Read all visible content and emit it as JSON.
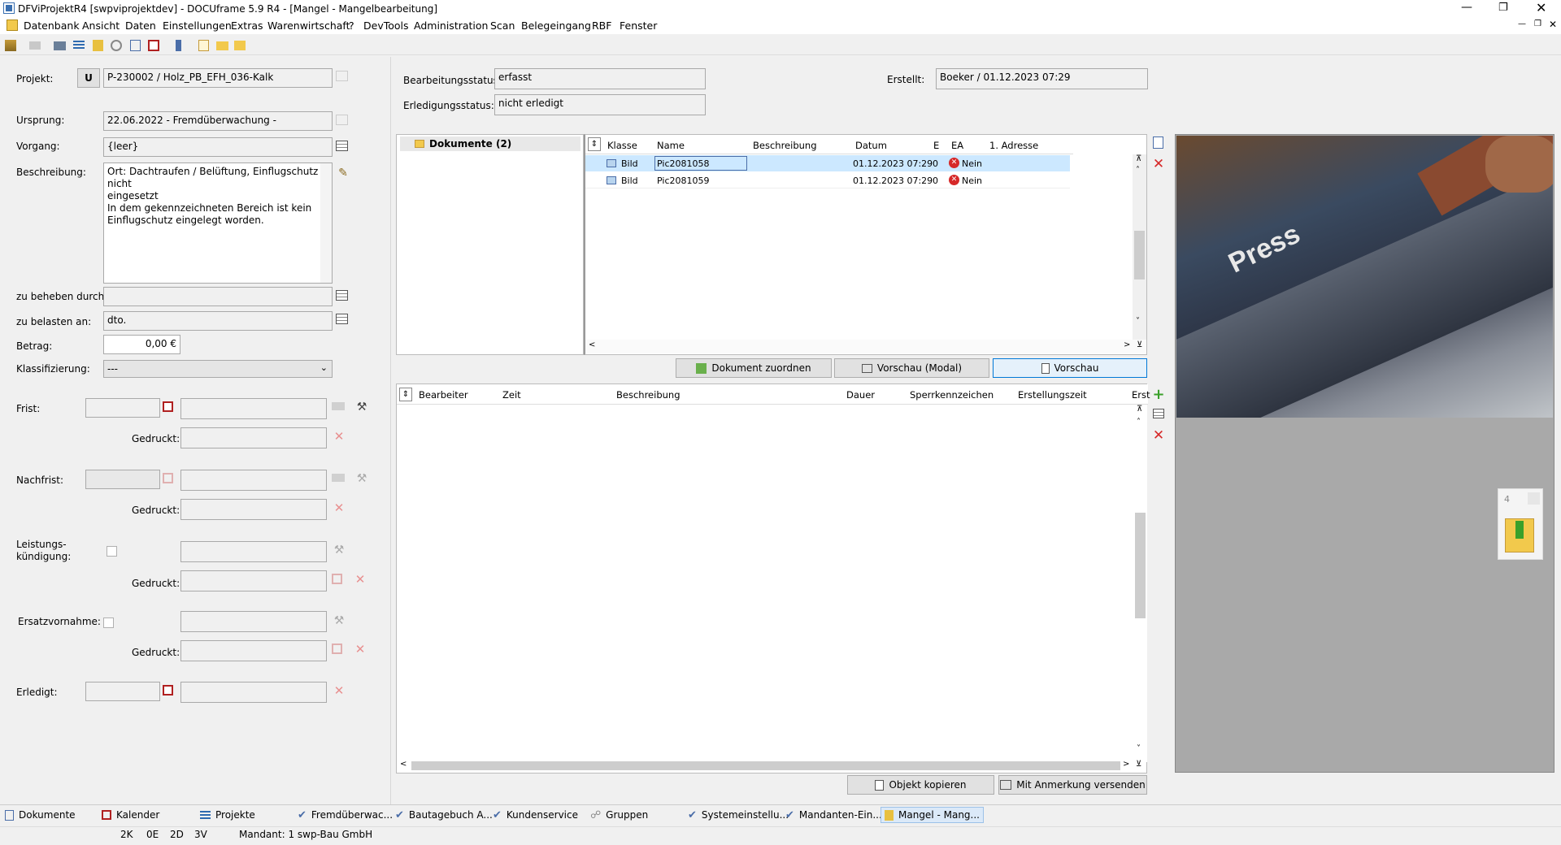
{
  "window": {
    "title": "DFViProjektR4 [swpviprojektdev] - DOCUframe 5.9 R4 - [Mangel - Mangelbearbeitung]"
  },
  "menu": [
    "Datenbank",
    "Ansicht",
    "Daten",
    "Einstellungen",
    "Extras",
    "Warenwirtschaft",
    "?",
    "DevTools",
    "Administration",
    "Scan",
    "Belegeingang",
    "RBF",
    "Fenster"
  ],
  "form": {
    "projekt_label": "Projekt:",
    "projekt_u": "U",
    "projekt_value": "P-230002 / Holz_PB_EFH_036-Kalk",
    "ursprung_label": "Ursprung:",
    "ursprung_value": "22.06.2022 - Fremdüberwachung -",
    "vorgang_label": "Vorgang:",
    "vorgang_value": "{leer}",
    "beschreibung_label": "Beschreibung:",
    "beschreibung_lines": [
      "Ort: Dachtraufen / Belüftung, Einflugschutz nicht",
      "eingesetzt",
      "In dem gekennzeichneten Bereich ist kein",
      "Einflugschutz eingelegt worden."
    ],
    "beheben_label": "zu beheben durch:",
    "beheben_value": "",
    "belasten_label": "zu belasten an:",
    "belasten_value": "dto.",
    "betrag_label": "Betrag:",
    "betrag_value": "0,00 €",
    "klass_label": "Klassifizierung:",
    "klass_value": "---",
    "frist_label": "Frist:",
    "gedruckt_label": "Gedruckt:",
    "nachfrist_label": "Nachfrist:",
    "leistung_label1": "Leistungs-",
    "leistung_label2": "kündigung:",
    "ersatz_label": "Ersatzvornahme:",
    "erledigt_label": "Erledigt:"
  },
  "status": {
    "bearb_label": "Bearbeitungsstatus:",
    "bearb_value": "erfasst",
    "erled_label": "Erledigungsstatus:",
    "erled_value": "nicht erledigt",
    "erstellt_label": "Erstellt:",
    "erstellt_value": "Boeker / 01.12.2023 07:29"
  },
  "docs": {
    "tree_label": "Dokumente (2)",
    "columns": [
      "Klasse",
      "Name",
      "Beschreibung",
      "Datum",
      "E",
      "EA",
      "1. Adresse"
    ],
    "rows": [
      {
        "klasse": "Bild",
        "name": "Pic2081058",
        "beschreibung": "",
        "datum": "01.12.2023 07:29",
        "e": "0",
        "ea": "Nein",
        "adresse": ""
      },
      {
        "klasse": "Bild",
        "name": "Pic2081059",
        "beschreibung": "",
        "datum": "01.12.2023 07:29",
        "e": "0",
        "ea": "Nein",
        "adresse": ""
      }
    ],
    "btn_zuordnen": "Dokument zuordnen",
    "btn_vorschau_modal": "Vorschau (Modal)",
    "btn_vorschau": "Vorschau"
  },
  "tasks": {
    "columns": [
      "Bearbeiter",
      "Zeit",
      "Beschreibung",
      "Dauer",
      "Sperrkennzeichen",
      "Erstellungszeit",
      "Erst"
    ],
    "btn_kopieren": "Objekt kopieren",
    "btn_versenden": "Mit Anmerkung versenden"
  },
  "preview": {
    "photo_text": "Press",
    "page_number": "4"
  },
  "tabs": [
    "Dokumente",
    "Kalender",
    "Projekte",
    "Fremdüberwac...",
    "Bautagebuch A...",
    "Kundenservice",
    "Gruppen",
    "Systemeinstellu...",
    "Mandanten-Ein...",
    "Mangel - Mang..."
  ],
  "statusbar": {
    "k": "2K",
    "e": "0E",
    "d": "2D",
    "v": "3V",
    "mandant": "Mandant: 1 swp-Bau GmbH"
  },
  "colors": {
    "accent": "#0078d7",
    "selection": "#cce8ff",
    "error": "#d62828"
  }
}
